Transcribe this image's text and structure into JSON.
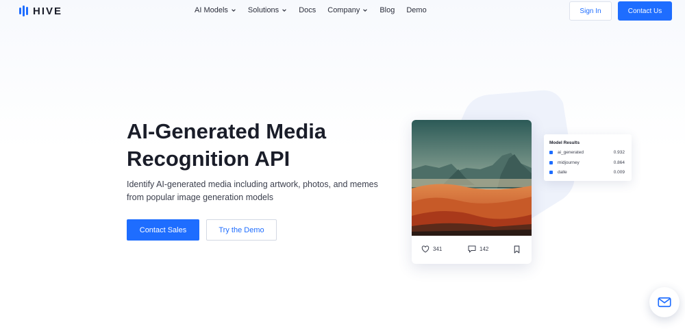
{
  "nav": {
    "logo_text": "HIVE",
    "menu": [
      {
        "label": "AI Models",
        "dropdown": true
      },
      {
        "label": "Solutions",
        "dropdown": true
      },
      {
        "label": "Docs",
        "dropdown": false
      },
      {
        "label": "Company",
        "dropdown": true
      },
      {
        "label": "Blog",
        "dropdown": false
      },
      {
        "label": "Demo",
        "dropdown": false
      }
    ],
    "sign_in": "Sign In",
    "contact_us": "Contact Us"
  },
  "hero": {
    "title_line1": "AI-Generated Media",
    "title_line2": "Recognition API",
    "subtitle": "Identify AI-generated media including artwork, photos, and memes from popular image generation models",
    "cta_primary": "Contact Sales",
    "cta_secondary": "Try the Demo"
  },
  "post": {
    "likes": "341",
    "comments": "142"
  },
  "model_results": {
    "title": "Model Results",
    "rows": [
      {
        "label": "ai_generated",
        "score": "0.932"
      },
      {
        "label": "midjourney",
        "score": "0.864"
      },
      {
        "label": "dalle",
        "score": "0.009"
      }
    ]
  },
  "colors": {
    "brand_blue": "#1e6dff",
    "text_dark": "#1a1d29"
  },
  "icons": {
    "chevron": "chevron-down-icon",
    "like": "heart-icon",
    "comment": "comment-icon",
    "save": "bookmark-icon",
    "chat": "mail-icon"
  }
}
